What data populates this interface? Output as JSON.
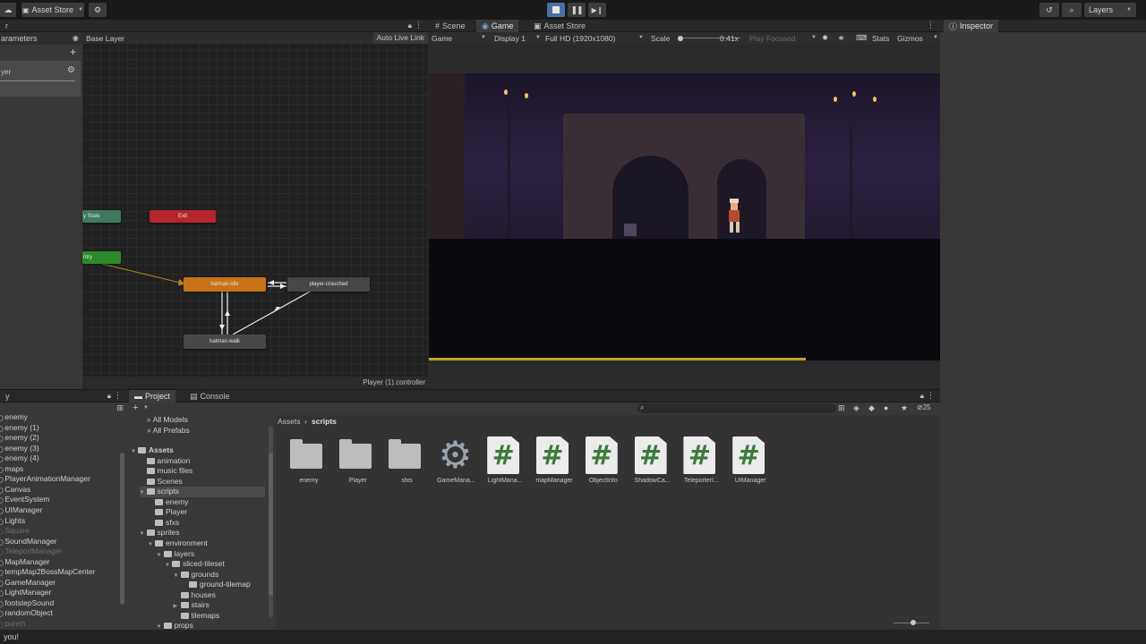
{
  "toolbar": {
    "asset_store": "Asset Store",
    "layers": "Layers",
    "play_icon": "play-icon",
    "pause_icon": "pause-icon",
    "step_icon": "step-icon"
  },
  "animator": {
    "tab_parameters": "arameters",
    "base_layer": "Base Layer",
    "auto_live_link": "Auto Live Link",
    "layer_field": "yer",
    "footer": "Player (1).controller",
    "nodes": {
      "any_state": "y State",
      "exit": "Exit",
      "entry": "ntry",
      "idle": "hatman-idle",
      "crouched": "player-crouched",
      "walk": "hatman-walk"
    }
  },
  "game": {
    "tabs": [
      "Scene",
      "Game",
      "Asset Store"
    ],
    "mode": "Game",
    "display": "Display 1",
    "resolution": "Full HD (1920x1080)",
    "scale_label": "Scale",
    "scale_value": "0.41x",
    "play_focused": "Play Focused",
    "stats": "Stats",
    "gizmos": "Gizmos"
  },
  "inspector": {
    "title": "Inspector"
  },
  "hierarchy": {
    "items": [
      {
        "label": "enemy",
        "dim": false
      },
      {
        "label": "enemy (1)",
        "dim": false
      },
      {
        "label": "enemy (2)",
        "dim": false
      },
      {
        "label": "enemy (3)",
        "dim": false
      },
      {
        "label": "enemy (4)",
        "dim": false
      },
      {
        "label": "maps",
        "dim": false
      },
      {
        "label": "PlayerAnimationManager",
        "dim": false
      },
      {
        "label": "Canvas",
        "dim": false
      },
      {
        "label": "EventSystem",
        "dim": false
      },
      {
        "label": "UIManager",
        "dim": false
      },
      {
        "label": "Lights",
        "dim": false
      },
      {
        "label": "Square",
        "dim": true
      },
      {
        "label": "SoundManager",
        "dim": false
      },
      {
        "label": "TeleportManager",
        "dim": true
      },
      {
        "label": "MapManager",
        "dim": false
      },
      {
        "label": "tempMap2BossMapCenter",
        "dim": false
      },
      {
        "label": "GameManager",
        "dim": false
      },
      {
        "label": "LightManager",
        "dim": false
      },
      {
        "label": "footstepSound",
        "dim": false
      },
      {
        "label": "randomObject",
        "dim": false
      },
      {
        "label": "punch",
        "dim": true
      }
    ]
  },
  "project": {
    "tabs": [
      "Project",
      "Console"
    ],
    "favorites": [
      "All Models",
      "All Prefabs"
    ],
    "tree": [
      {
        "label": "Assets",
        "indent": 0,
        "arrow": "▼",
        "bold": true
      },
      {
        "label": "animation",
        "indent": 1,
        "arrow": "",
        "bold": false
      },
      {
        "label": "music files",
        "indent": 1,
        "arrow": "",
        "bold": false
      },
      {
        "label": "Scenes",
        "indent": 1,
        "arrow": "",
        "bold": false
      },
      {
        "label": "scripts",
        "indent": 1,
        "arrow": "▼",
        "bold": false
      },
      {
        "label": "enemy",
        "indent": 2,
        "arrow": "",
        "bold": false
      },
      {
        "label": "Player",
        "indent": 2,
        "arrow": "",
        "bold": false
      },
      {
        "label": "sfxs",
        "indent": 2,
        "arrow": "",
        "bold": false
      },
      {
        "label": "sprites",
        "indent": 1,
        "arrow": "▼",
        "bold": false
      },
      {
        "label": "environment",
        "indent": 2,
        "arrow": "▼",
        "bold": false
      },
      {
        "label": "layers",
        "indent": 3,
        "arrow": "▼",
        "bold": false
      },
      {
        "label": "sliced-tileset",
        "indent": 4,
        "arrow": "▼",
        "bold": false
      },
      {
        "label": "grounds",
        "indent": 5,
        "arrow": "▼",
        "bold": false
      },
      {
        "label": "ground-tilemap",
        "indent": 6,
        "arrow": "",
        "bold": false
      },
      {
        "label": "houses",
        "indent": 5,
        "arrow": "",
        "bold": false
      },
      {
        "label": "stairs",
        "indent": 5,
        "arrow": "▶",
        "bold": false
      },
      {
        "label": "tilemaps",
        "indent": 5,
        "arrow": "",
        "bold": false
      },
      {
        "label": "props",
        "indent": 3,
        "arrow": "▼",
        "bold": false
      }
    ],
    "breadcrumb": [
      "Assets",
      "scripts"
    ],
    "hidden_count": "25",
    "assets": [
      {
        "label": "enemy",
        "kind": "folder"
      },
      {
        "label": "Player",
        "kind": "folder"
      },
      {
        "label": "sfxs",
        "kind": "folder"
      },
      {
        "label": "GameMana...",
        "kind": "gear"
      },
      {
        "label": "LightMana...",
        "kind": "script"
      },
      {
        "label": "mapManager",
        "kind": "script"
      },
      {
        "label": "ObjectInfo",
        "kind": "script"
      },
      {
        "label": "ShadowCa...",
        "kind": "script"
      },
      {
        "label": "TeleporterI...",
        "kind": "script"
      },
      {
        "label": "UIManager",
        "kind": "script"
      }
    ]
  },
  "status": {
    "text": "you!"
  },
  "colors": {
    "any_state": "#3e7a5e",
    "exit": "#b5262b",
    "entry": "#2a8a2a",
    "idle": "#c87218",
    "gray_node": "#474747",
    "progress": "#c8a028"
  }
}
